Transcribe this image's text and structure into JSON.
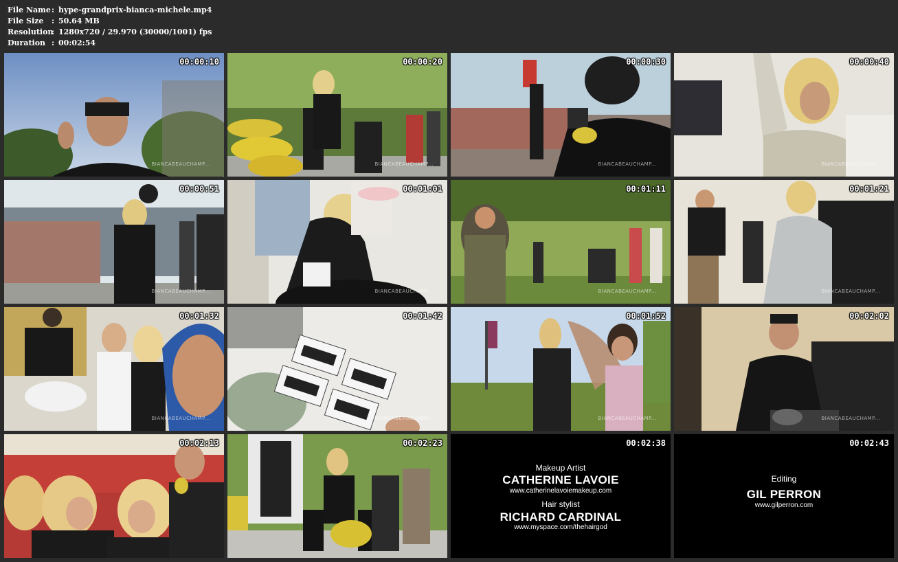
{
  "meta": {
    "file_name_label": "File Name",
    "file_name": "hype-grandprix-bianca-michele.mp4",
    "file_size_label": "File Size",
    "file_size": "50.64 MB",
    "resolution_label": "Resolution",
    "resolution": "1280x720 / 29.970 (30000/1001) fps",
    "duration_label": "Duration",
    "duration": "00:02:54",
    "separator": ":"
  },
  "thumbs": [
    {
      "time": "00:00:10",
      "watermark": "BIANCABEAUCHAMP..."
    },
    {
      "time": "00:00:20",
      "watermark": "BIANCABEAUCHAMP..."
    },
    {
      "time": "00:00:30",
      "watermark": "BIANCABEAUCHAMP..."
    },
    {
      "time": "00:00:40",
      "watermark": "BIANCABEAUCHAMP..."
    },
    {
      "time": "00:00:51",
      "watermark": "BIANCABEAUCHAMP..."
    },
    {
      "time": "00:01:01",
      "watermark": "BIANCABEAUCHAMP..."
    },
    {
      "time": "00:01:11",
      "watermark": "BIANCABEAUCHAMP..."
    },
    {
      "time": "00:01:21",
      "watermark": "BIANCABEAUCHAMP..."
    },
    {
      "time": "00:01:32",
      "watermark": "BIANCABEAUCHAMP..."
    },
    {
      "time": "00:01:42",
      "watermark": "BIANCABEAUCHAMP..."
    },
    {
      "time": "00:01:52",
      "watermark": "BIANCABEAUCHAMP..."
    },
    {
      "time": "00:02:02",
      "watermark": "BIANCABEAUCHAMP..."
    },
    {
      "time": "00:02:13",
      "watermark": ""
    },
    {
      "time": "00:02:23",
      "watermark": ""
    },
    {
      "time": "00:02:38",
      "watermark": ""
    },
    {
      "time": "00:02:43",
      "watermark": ""
    }
  ],
  "credits_1": {
    "role1": "Makeup Artist",
    "name1": "CATHERINE LAVOIE",
    "url1": "www.catherinelavoiemakeup.com",
    "role2": "Hair stylist",
    "name2": "RICHARD CARDINAL",
    "url2": "www.myspace.com/thehairgod"
  },
  "credits_2": {
    "role1": "Editing",
    "name1": "GIL PERRON",
    "url1": "www.gilperron.com"
  },
  "colors": {
    "background": "#2b2b2b",
    "text": "#ffffff"
  }
}
